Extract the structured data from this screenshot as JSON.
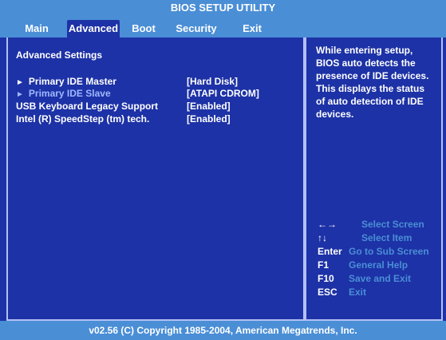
{
  "title": "BIOS SETUP UTILITY",
  "menu": {
    "tabs": [
      {
        "label": "Main"
      },
      {
        "label": "Advanced"
      },
      {
        "label": "Boot"
      },
      {
        "label": "Security"
      },
      {
        "label": "Exit"
      }
    ],
    "active": "Advanced"
  },
  "main": {
    "section_title": "Advanced Settings",
    "items": [
      {
        "label": "Primary IDE Master",
        "value": "[Hard Disk]",
        "submenu": true,
        "selected": true
      },
      {
        "label": "Primary IDE Slave",
        "value": "[ATAPI CDROM]",
        "submenu": true,
        "selected": false
      },
      {
        "label": "USB Keyboard Legacy Support",
        "value": "[Enabled]",
        "submenu": false
      },
      {
        "label": "Intel (R) SpeedStep (tm) tech.",
        "value": "[Enabled]",
        "submenu": false
      }
    ]
  },
  "help": {
    "text": "While entering setup, BIOS auto detects the presence of IDE devices.  This displays the status of auto detection of IDE devices.",
    "keys": [
      {
        "key": "←→",
        "desc": "Select Screen"
      },
      {
        "key": "↑↓",
        "desc": "Select Item"
      },
      {
        "key": "Enter",
        "desc": "Go to Sub Screen"
      },
      {
        "key": "F1",
        "desc": "General Help"
      },
      {
        "key": "F10",
        "desc": "Save and Exit"
      },
      {
        "key": "ESC",
        "desc": "Exit"
      }
    ]
  },
  "footer": "v02.56 (C) Copyright  1985-2004, American Megatrends, Inc.",
  "colors": {
    "background": "#1d32a6",
    "bar": "#4a8ed6",
    "text": "#ffffff",
    "key_desc": "#4a8ed6",
    "submenu_label": "#a0b8ff"
  }
}
